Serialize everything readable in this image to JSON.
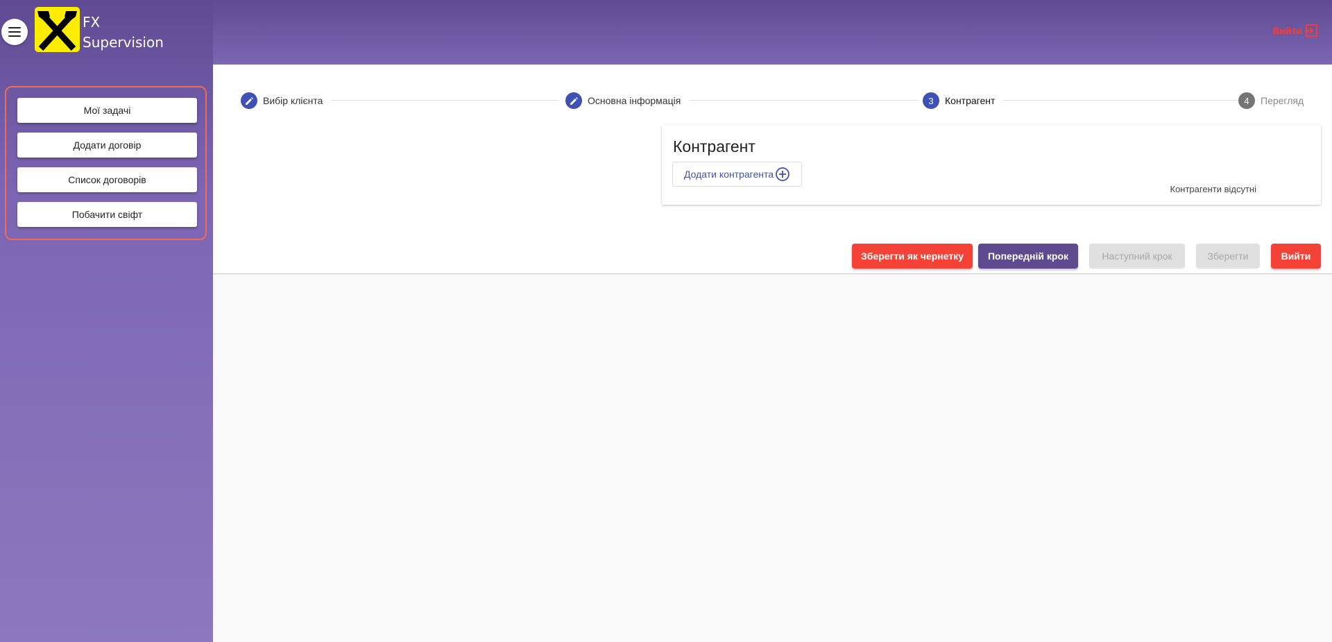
{
  "brand": {
    "line1": "FX",
    "line2": "Supervision"
  },
  "header": {
    "logout_label": "Вийти"
  },
  "sidebar": {
    "items": [
      {
        "label": "Мої задачі"
      },
      {
        "label": "Додати договір"
      },
      {
        "label": "Список договорів"
      },
      {
        "label": "Побачити свіфт"
      }
    ]
  },
  "stepper": {
    "steps": [
      {
        "label": "Вибір клієнта",
        "icon": "pencil-icon"
      },
      {
        "label": "Основна інформація",
        "icon": "pencil-icon"
      },
      {
        "label": "Контрагент",
        "number": "3"
      },
      {
        "label": "Перегляд",
        "number": "4"
      }
    ]
  },
  "panel": {
    "title": "Контрагент",
    "add_label": "Додати контрагента",
    "empty_text": "Контрагенти відсутні"
  },
  "actions": {
    "save_draft": "Зберегти як чернетку",
    "prev_step": "Попередній крок",
    "next_step": "Наступний крок",
    "save": "Зберегти",
    "logout": "Вийти"
  },
  "colors": {
    "primary": "#3f51b5",
    "danger": "#f44336",
    "brand_purple": "#5e4a8f",
    "logo_yellow": "#ffed00"
  }
}
